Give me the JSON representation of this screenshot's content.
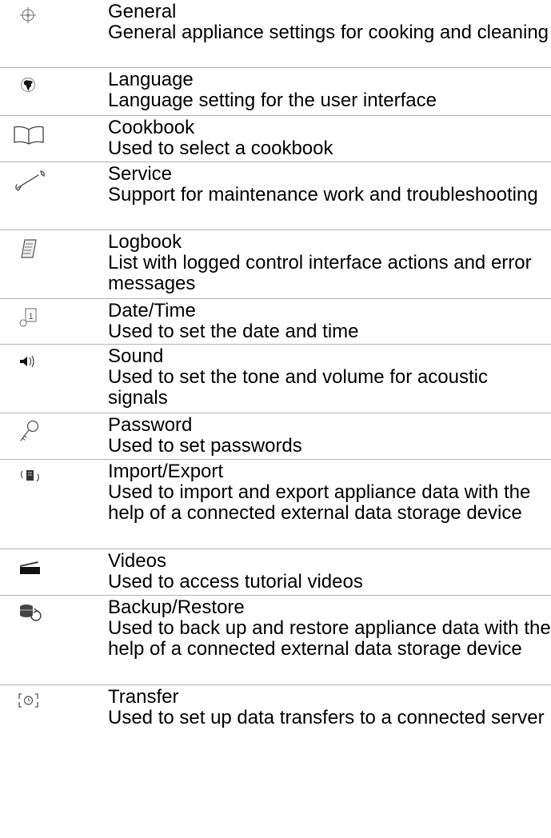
{
  "rows": [
    {
      "icon": "steering-wheel-icon",
      "title": "General",
      "description": "General appliance settings for cooking and cleaning"
    },
    {
      "icon": "globe-icon",
      "title": "Language",
      "description": "Language setting for the user interface"
    },
    {
      "icon": "open-book-icon",
      "title": "Cookbook",
      "description": "Used to select a cookbook"
    },
    {
      "icon": "wrench-icon",
      "title": "Service",
      "description": "Support for maintenance work and troubleshooting"
    },
    {
      "icon": "notepad-icon",
      "title": "Logbook",
      "description": "List with logged control interface actions and error messages"
    },
    {
      "icon": "calendar-clock-icon",
      "title": "Date/Time",
      "description": "Used to set the date and time"
    },
    {
      "icon": "speaker-icon",
      "title": "Sound",
      "description": "Used to set the tone and volume for acoustic signals"
    },
    {
      "icon": "key-icon",
      "title": "Password",
      "description": "Used to set passwords"
    },
    {
      "icon": "import-export-icon",
      "title": "Import/Export",
      "description": "Used to import and export appliance data with the help of a connected external data storage device"
    },
    {
      "icon": "clapperboard-icon",
      "title": "Videos",
      "description": "Used to access tutorial videos"
    },
    {
      "icon": "database-restore-icon",
      "title": "Backup/Restore",
      "description": "Used to back up and restore appliance data with the help of a connected external data storage device"
    },
    {
      "icon": "transfer-icon",
      "title": "Transfer",
      "description": "Used to set up data transfers to a connected server"
    }
  ]
}
